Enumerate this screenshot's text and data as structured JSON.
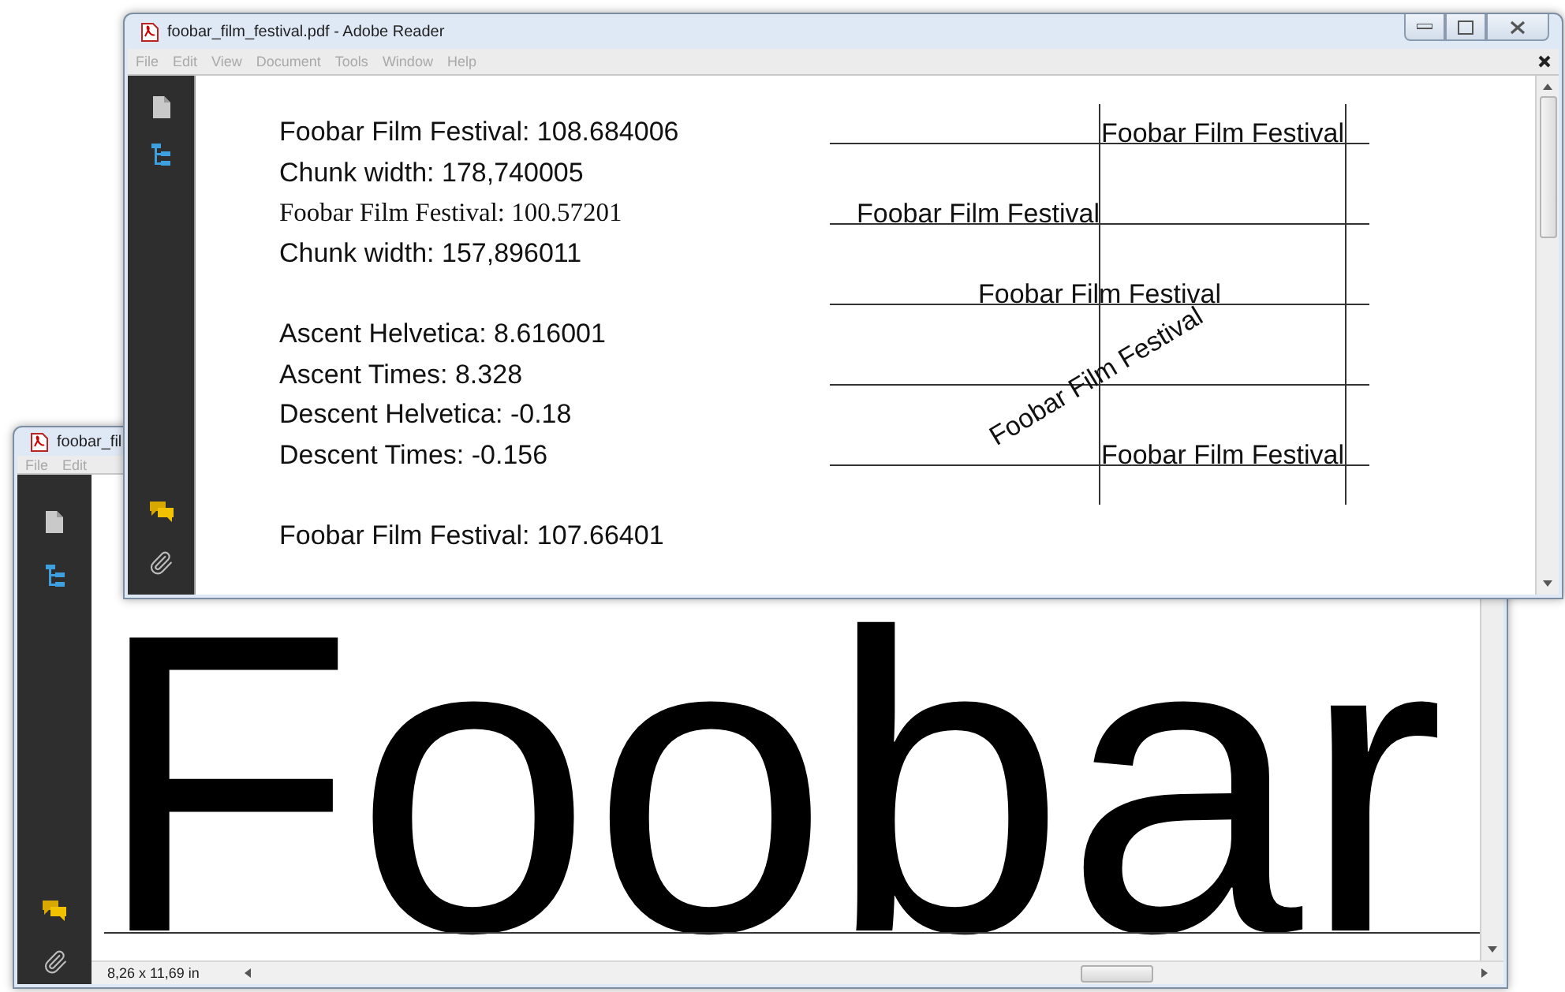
{
  "back_window": {
    "title": "foobar_fil",
    "menu": [
      "File",
      "Edit"
    ],
    "page_text": "Foobar",
    "status": "8,26 x 11,69 in"
  },
  "front_window": {
    "title": "foobar_film_festival.pdf - Adobe Reader",
    "menu": [
      {
        "label": "File",
        "disabled": true
      },
      {
        "label": "Edit",
        "disabled": true
      },
      {
        "label": "View",
        "disabled": true
      },
      {
        "label": "Document",
        "disabled": true
      },
      {
        "label": "Tools",
        "disabled": true
      },
      {
        "label": "Window",
        "disabled": true
      },
      {
        "label": "Help",
        "disabled": true
      }
    ],
    "text_blocks": [
      [
        {
          "text": "Foobar Film Festival: 108.684006",
          "kind": "sans"
        },
        {
          "text": "Chunk width: 178,740005",
          "kind": "sans"
        },
        {
          "text": "Foobar Film Festival: 100.57201",
          "kind": "serif"
        },
        {
          "text": "Chunk width: 157,896011",
          "kind": "sans"
        }
      ],
      [
        {
          "text": "Ascent Helvetica: 8.616001",
          "kind": "sans"
        },
        {
          "text": "Ascent Times: 8.328",
          "kind": "sans"
        },
        {
          "text": "Descent Helvetica: -0.18",
          "kind": "sans"
        },
        {
          "text": "Descent Times: -0.156",
          "kind": "sans"
        }
      ],
      [
        {
          "text": "Foobar Film Festival: 107.66401",
          "kind": "sans"
        }
      ]
    ],
    "diagram_labels": [
      {
        "text": "Foobar Film Festival",
        "kind": "left"
      },
      {
        "text": "Foobar Film Festival",
        "kind": "right"
      },
      {
        "text": "Foobar Film Festival",
        "kind": "center"
      },
      {
        "text": "Foobar Film Festival",
        "kind": "rotated"
      },
      {
        "text": "Foobar Film Festival",
        "kind": "left"
      }
    ]
  }
}
